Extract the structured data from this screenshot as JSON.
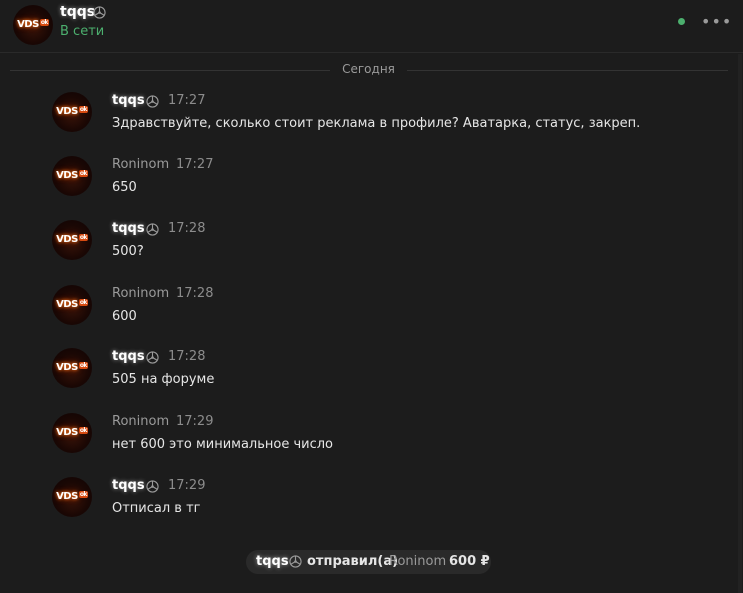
{
  "header": {
    "name": "tqqs",
    "status": "В сети",
    "avatar_logo": "VDS",
    "avatar_badge": "ok"
  },
  "divider": {
    "label": "Сегодня"
  },
  "messages": [
    {
      "author": "tqqs",
      "time": "17:27",
      "text": "Здравствуйте, сколько стоит реклама в профиле? Аватарка, статус, закреп."
    },
    {
      "author": "Roninom",
      "time": "17:27",
      "text": "650"
    },
    {
      "author": "tqqs",
      "time": "17:28",
      "text": "500?"
    },
    {
      "author": "Roninom",
      "time": "17:28",
      "text": "600"
    },
    {
      "author": "tqqs",
      "time": "17:28",
      "text": "505 на форуме"
    },
    {
      "author": "Roninom",
      "time": "17:29",
      "text": "нет 600 это минимальное число"
    },
    {
      "author": "tqqs",
      "time": "17:29",
      "text": "Отписал в тг"
    }
  ],
  "transfer": {
    "from": "tqqs",
    "verb": "отправил(а)",
    "to": "Roninom",
    "amount": "600 ₽"
  },
  "colors": {
    "background": "#1c1c1c",
    "online": "#4caf6e",
    "muted": "#9a9a9a"
  },
  "icons": {
    "badge": "steering-wheel-icon",
    "menu": "more-horizontal-icon"
  }
}
